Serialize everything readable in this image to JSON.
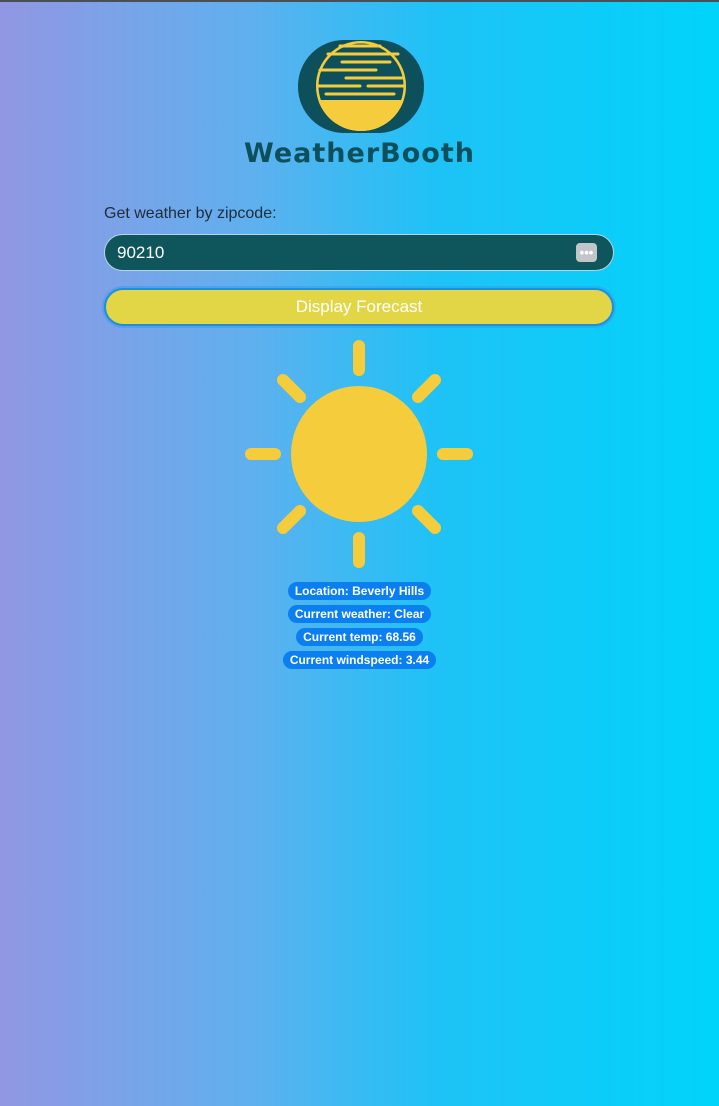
{
  "app": {
    "brand_name": "WeatherBooth"
  },
  "search": {
    "label": "Get weather by zipcode:",
    "value": "90210",
    "autofill_icon_glyph": "•••"
  },
  "actions": {
    "display_forecast_label": "Display Forecast"
  },
  "weather_icon": "sun-icon",
  "results": {
    "location": "Location: Beverly Hills",
    "weather": "Current weather: Clear",
    "temp": "Current temp: 68.56",
    "windspeed": "Current windspeed: 3.44"
  },
  "colors": {
    "brand_dark": "#0e4f5c",
    "brand_yellow": "#f5cc3b",
    "button": "#e3d646",
    "pill": "#0c7ff0"
  }
}
